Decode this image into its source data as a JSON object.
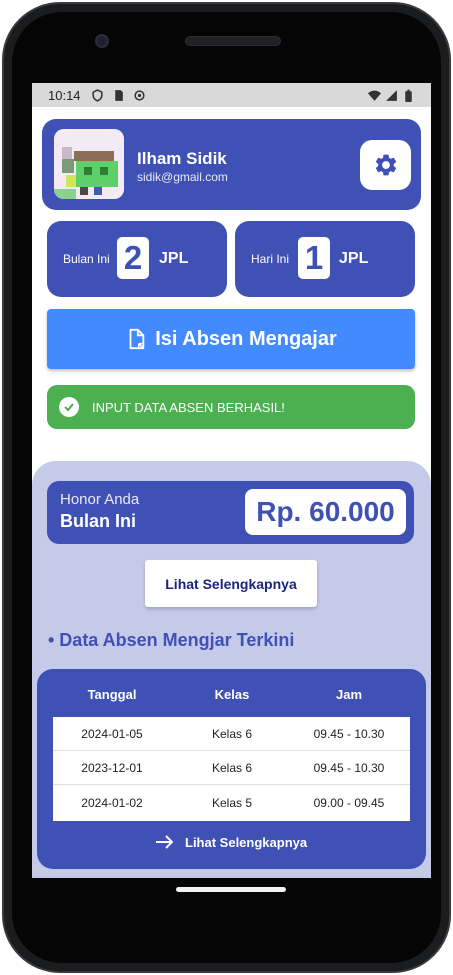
{
  "status_bar": {
    "time": "10:14"
  },
  "profile": {
    "name": "Ilham Sidik",
    "email": "sidik@gmail.com"
  },
  "stats": [
    {
      "label": "Bulan Ini",
      "value": "2",
      "unit": "JPL"
    },
    {
      "label": "Hari Ini",
      "value": "1",
      "unit": "JPL"
    }
  ],
  "absen_button": {
    "label": "Isi Absen Mengajar"
  },
  "alert": {
    "message": "INPUT DATA ABSEN BERHASIL!",
    "color": "#4caf50"
  },
  "honor": {
    "label": "Honor Anda",
    "period": "Bulan Ini",
    "amount": "Rp. 60.000"
  },
  "more_button": {
    "label": "Lihat Selengkapnya"
  },
  "section": {
    "title": "• Data Absen Mengjar Terkini"
  },
  "table": {
    "headers": [
      "Tanggal",
      "Kelas",
      "Jam"
    ],
    "rows": [
      [
        "2024-01-05",
        "Kelas 6",
        "09.45 - 10.30"
      ],
      [
        "2023-12-01",
        "Kelas 6",
        "09.45 - 10.30"
      ],
      [
        "2024-01-02",
        "Kelas 5",
        "09.00 - 09.45"
      ]
    ],
    "more_label": "Lihat Selengkapnya"
  },
  "colors": {
    "primary": "#3f51b5",
    "accent": "#448aff",
    "panel": "#c5cae9",
    "success": "#4caf50"
  },
  "icons": {
    "settings": "gear-icon",
    "absen": "document-icon",
    "alert": "check-circle-icon",
    "more": "arrow-right-icon"
  }
}
